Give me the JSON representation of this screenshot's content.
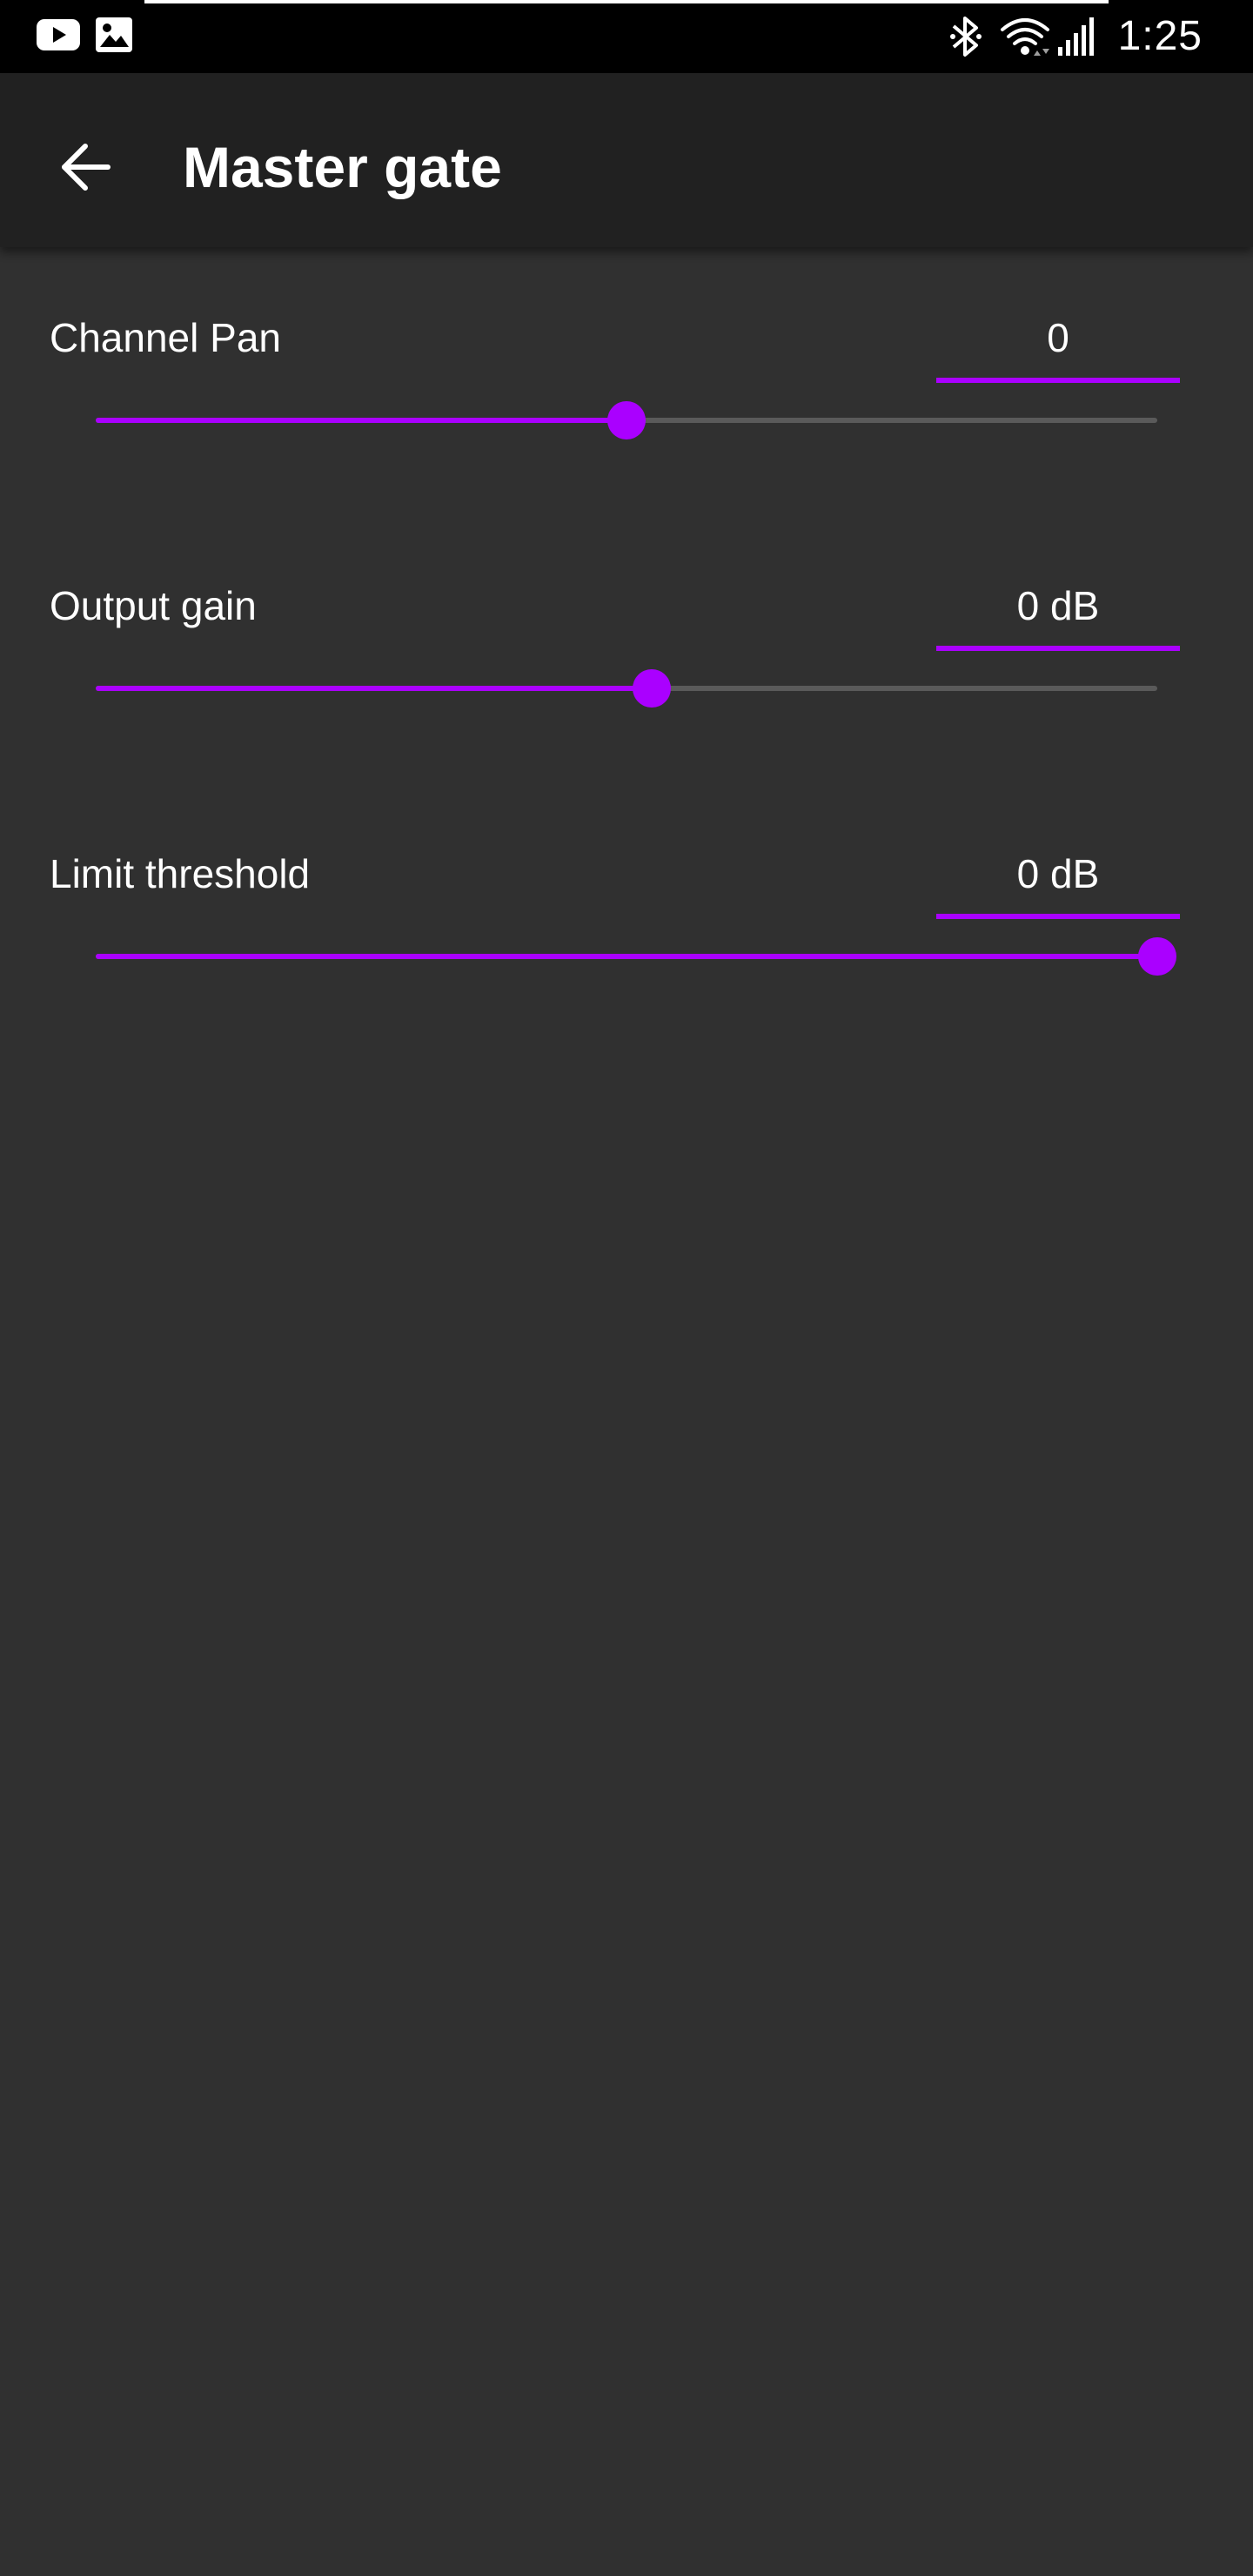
{
  "status_bar": {
    "time": "1:25",
    "left_icons": [
      "youtube-icon",
      "image-icon"
    ],
    "right_icons": [
      "bluetooth-icon",
      "wifi-icon",
      "signal-icon"
    ]
  },
  "app_bar": {
    "title": "Master gate",
    "back_icon": "arrow-back-icon"
  },
  "settings": [
    {
      "label": "Channel Pan",
      "value": "0",
      "slider_fraction": 0.5
    },
    {
      "label": "Output gain",
      "value": "0 dB",
      "slider_fraction": 0.524
    },
    {
      "label": "Limit threshold",
      "value": "0 dB",
      "slider_fraction": 1.0
    }
  ],
  "colors": {
    "accent": "#aa00ff",
    "background": "#303030",
    "app_bar": "#212121",
    "status_bar": "#000000",
    "track_inactive": "#5a5a5a",
    "text": "#ffffff"
  }
}
